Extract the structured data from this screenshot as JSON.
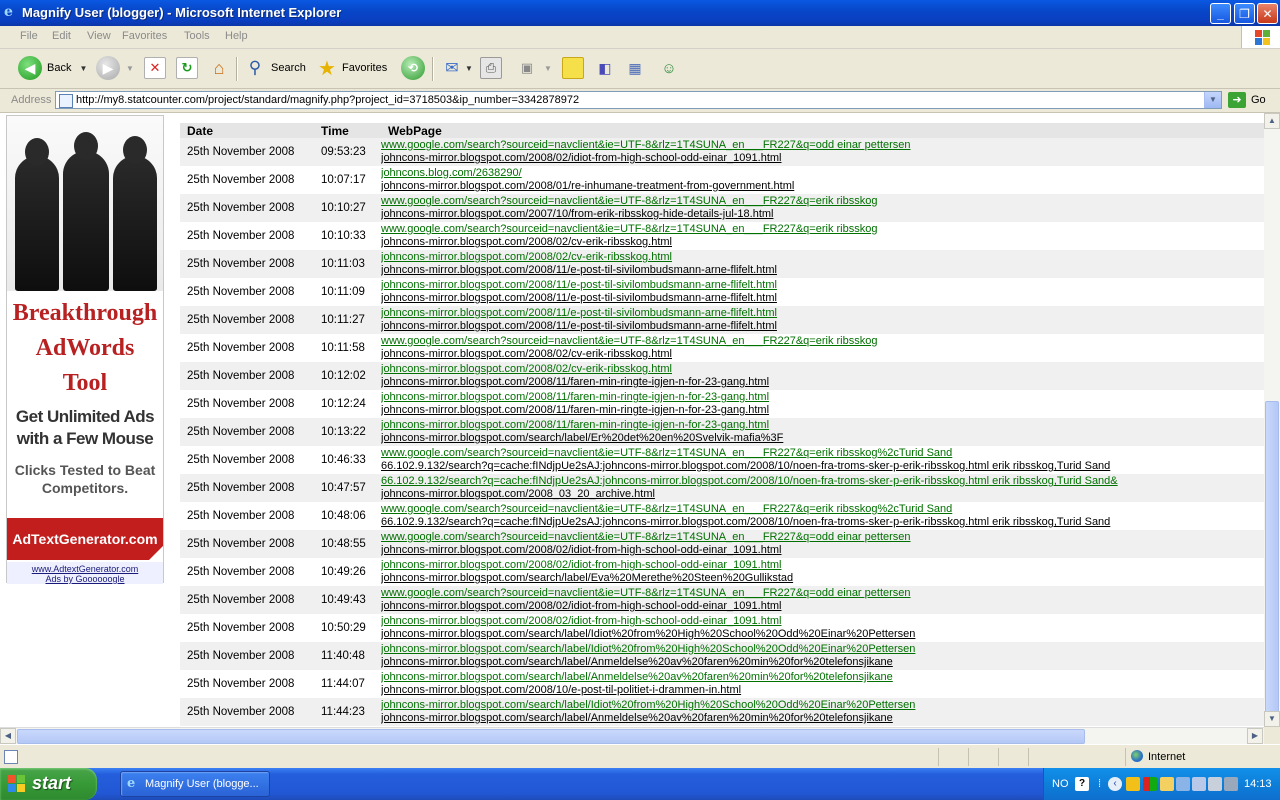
{
  "window": {
    "title": "Magnify User (blogger) - Microsoft Internet Explorer"
  },
  "menu": [
    "File",
    "Edit",
    "View",
    "Favorites",
    "Tools",
    "Help"
  ],
  "toolbar": {
    "back": "Back",
    "search": "Search",
    "favorites": "Favorites"
  },
  "address": {
    "label": "Address",
    "url": "http://my8.statcounter.com/project/standard/magnify.php?project_id=3718503&ip_number=3342878972",
    "go": "Go"
  },
  "ad": {
    "headline": [
      "Breakthrough",
      "AdWords",
      "Tool"
    ],
    "sub": [
      "Get Unlimited Ads",
      "with a Few Mouse"
    ],
    "sub2": [
      "Clicks Tested to Beat",
      "Competitors."
    ],
    "banner": "AdTextGenerator.com",
    "footer": [
      "www.AdtextGenerator.com",
      "Ads by Goooooogle"
    ]
  },
  "table": {
    "headers": [
      "Date",
      "Time",
      "WebPage"
    ],
    "rows": [
      {
        "date": "25th November 2008",
        "time": "09:53:23",
        "ref": "www.google.com/search?sourceid=navclient&ie=UTF-8&rlz=1T4SUNA_en___FR227&q=odd einar pettersen",
        "page": "johncons-mirror.blogspot.com/2008/02/idiot-from-high-school-odd-einar_1091.html"
      },
      {
        "date": "25th November 2008",
        "time": "10:07:17",
        "ref": "johncons.blog.com/2638290/",
        "page": "johncons-mirror.blogspot.com/2008/01/re-inhumane-treatment-from-government.html"
      },
      {
        "date": "25th November 2008",
        "time": "10:10:27",
        "ref": "www.google.com/search?sourceid=navclient&ie=UTF-8&rlz=1T4SUNA_en___FR227&q=erik ribsskog",
        "page": "johncons-mirror.blogspot.com/2007/10/from-erik-ribsskog-hide-details-jul-18.html"
      },
      {
        "date": "25th November 2008",
        "time": "10:10:33",
        "ref": "www.google.com/search?sourceid=navclient&ie=UTF-8&rlz=1T4SUNA_en___FR227&q=erik ribsskog",
        "page": "johncons-mirror.blogspot.com/2008/02/cv-erik-ribsskog.html"
      },
      {
        "date": "25th November 2008",
        "time": "10:11:03",
        "ref": "johncons-mirror.blogspot.com/2008/02/cv-erik-ribsskog.html",
        "page": "johncons-mirror.blogspot.com/2008/11/e-post-til-sivilombudsmann-arne-flifelt.html"
      },
      {
        "date": "25th November 2008",
        "time": "10:11:09",
        "ref": "johncons-mirror.blogspot.com/2008/11/e-post-til-sivilombudsmann-arne-flifelt.html",
        "page": "johncons-mirror.blogspot.com/2008/11/e-post-til-sivilombudsmann-arne-flifelt.html"
      },
      {
        "date": "25th November 2008",
        "time": "10:11:27",
        "ref": "johncons-mirror.blogspot.com/2008/11/e-post-til-sivilombudsmann-arne-flifelt.html",
        "page": "johncons-mirror.blogspot.com/2008/11/e-post-til-sivilombudsmann-arne-flifelt.html"
      },
      {
        "date": "25th November 2008",
        "time": "10:11:58",
        "ref": "www.google.com/search?sourceid=navclient&ie=UTF-8&rlz=1T4SUNA_en___FR227&q=erik ribsskog",
        "page": "johncons-mirror.blogspot.com/2008/02/cv-erik-ribsskog.html"
      },
      {
        "date": "25th November 2008",
        "time": "10:12:02",
        "ref": "johncons-mirror.blogspot.com/2008/02/cv-erik-ribsskog.html",
        "page": "johncons-mirror.blogspot.com/2008/11/faren-min-ringte-igjen-n-for-23-gang.html"
      },
      {
        "date": "25th November 2008",
        "time": "10:12:24",
        "ref": "johncons-mirror.blogspot.com/2008/11/faren-min-ringte-igjen-n-for-23-gang.html",
        "page": "johncons-mirror.blogspot.com/2008/11/faren-min-ringte-igjen-n-for-23-gang.html"
      },
      {
        "date": "25th November 2008",
        "time": "10:13:22",
        "ref": "johncons-mirror.blogspot.com/2008/11/faren-min-ringte-igjen-n-for-23-gang.html",
        "page": "johncons-mirror.blogspot.com/search/label/Er%20det%20en%20Svelvik-mafia%3F"
      },
      {
        "date": "25th November 2008",
        "time": "10:46:33",
        "ref": "www.google.com/search?sourceid=navclient&ie=UTF-8&rlz=1T4SUNA_en___FR227&q=erik ribsskog%2cTurid Sand",
        "page": "66.102.9.132/search?q=cache:fINdjpUe2sAJ:johncons-mirror.blogspot.com/2008/10/noen-fra-troms-sker-p-erik-ribsskog.html erik ribsskog,Turid Sand"
      },
      {
        "date": "25th November 2008",
        "time": "10:47:57",
        "ref": "66.102.9.132/search?q=cache:fINdjpUe2sAJ:johncons-mirror.blogspot.com/2008/10/noen-fra-troms-sker-p-erik-ribsskog.html erik ribsskog,Turid Sand&",
        "page": "johncons-mirror.blogspot.com/2008_03_20_archive.html"
      },
      {
        "date": "25th November 2008",
        "time": "10:48:06",
        "ref": "www.google.com/search?sourceid=navclient&ie=UTF-8&rlz=1T4SUNA_en___FR227&q=erik ribsskog%2cTurid Sand",
        "page": "66.102.9.132/search?q=cache:fINdjpUe2sAJ:johncons-mirror.blogspot.com/2008/10/noen-fra-troms-sker-p-erik-ribsskog.html erik ribsskog,Turid Sand"
      },
      {
        "date": "25th November 2008",
        "time": "10:48:55",
        "ref": "www.google.com/search?sourceid=navclient&ie=UTF-8&rlz=1T4SUNA_en___FR227&q=odd einar pettersen",
        "page": "johncons-mirror.blogspot.com/2008/02/idiot-from-high-school-odd-einar_1091.html"
      },
      {
        "date": "25th November 2008",
        "time": "10:49:26",
        "ref": "johncons-mirror.blogspot.com/2008/02/idiot-from-high-school-odd-einar_1091.html",
        "page": "johncons-mirror.blogspot.com/search/label/Eva%20Merethe%20Steen%20Gullikstad"
      },
      {
        "date": "25th November 2008",
        "time": "10:49:43",
        "ref": "www.google.com/search?sourceid=navclient&ie=UTF-8&rlz=1T4SUNA_en___FR227&q=odd einar pettersen",
        "page": "johncons-mirror.blogspot.com/2008/02/idiot-from-high-school-odd-einar_1091.html"
      },
      {
        "date": "25th November 2008",
        "time": "10:50:29",
        "ref": "johncons-mirror.blogspot.com/2008/02/idiot-from-high-school-odd-einar_1091.html",
        "page": "johncons-mirror.blogspot.com/search/label/Idiot%20from%20High%20School%20Odd%20Einar%20Pettersen"
      },
      {
        "date": "25th November 2008",
        "time": "11:40:48",
        "ref": "johncons-mirror.blogspot.com/search/label/Idiot%20from%20High%20School%20Odd%20Einar%20Pettersen",
        "page": "johncons-mirror.blogspot.com/search/label/Anmeldelse%20av%20faren%20min%20for%20telefonsjikane"
      },
      {
        "date": "25th November 2008",
        "time": "11:44:07",
        "ref": "johncons-mirror.blogspot.com/search/label/Anmeldelse%20av%20faren%20min%20for%20telefonsjikane",
        "page": "johncons-mirror.blogspot.com/2008/10/e-post-til-politiet-i-drammen-in.html"
      },
      {
        "date": "25th November 2008",
        "time": "11:44:23",
        "ref": "johncons-mirror.blogspot.com/search/label/Idiot%20from%20High%20School%20Odd%20Einar%20Pettersen",
        "page": "johncons-mirror.blogspot.com/search/label/Anmeldelse%20av%20faren%20min%20for%20telefonsjikane"
      }
    ]
  },
  "status": {
    "zone": "Internet"
  },
  "taskbar": {
    "start": "start",
    "item": "Magnify User (blogge...",
    "lang": "NO",
    "time": "14:13"
  },
  "colors": {
    "titlebar": "#0a50d8",
    "ref_link": "#007000",
    "page_link": "#000000",
    "ad_red": "#c21e1e",
    "start_green": "#3c9c3c"
  }
}
